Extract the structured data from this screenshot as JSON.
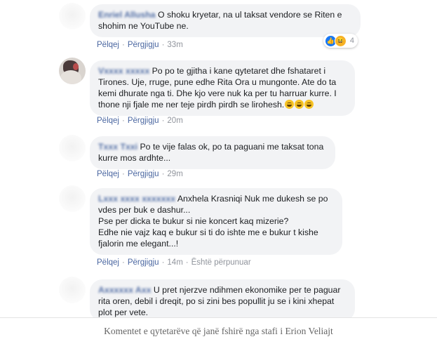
{
  "comments": [
    {
      "author": "Enriel Allusha",
      "text": "O shoku kryetar, na ul taksat vendore se Riten e shohim ne YouTube ne.",
      "actions": {
        "like": "Pëlqej",
        "reply": "Përgjigju",
        "time": "33m"
      },
      "reactions": {
        "icons": [
          "like-icon",
          "haha-icon"
        ],
        "count": "4"
      }
    },
    {
      "author": "Vxxxx xxxxx",
      "text": "Po po te gjitha i kane qytetaret dhe fshataret i Tirones. Uje, rruge, pune edhe Rita Ora u mungonte. Ate do ta kemi dhurate nga ti. Dhe kjo vere nuk ka per tu harruar kurre. I thone nji fjale me ner teje pirdh pirdh se lirohesh.",
      "emojis": [
        "laughing-emoji",
        "laughing-emoji",
        "laughing-emoji"
      ],
      "actions": {
        "like": "Pëlqej",
        "reply": "Përgjigju",
        "time": "20m"
      }
    },
    {
      "author": "Txxx Txxi",
      "text": "Po te vije falas ok, po ta paguani me taksat tona kurre mos ardhte...",
      "actions": {
        "like": "Pëlqej",
        "reply": "Përgjigju",
        "time": "29m"
      }
    },
    {
      "author": "Lxxx xxxx xxxxxxx",
      "text_lines": [
        "Anxhela Krasniqi Nuk me dukesh se po vdes per buk e dashur...",
        "Pse per dicka te bukur si nie koncert kaq mizerie?",
        "Edhe nie vajz kaq e bukur si ti do ishte me e bukur t kishe fjalorin me elegant...!"
      ],
      "actions": {
        "like": "Pëlqej",
        "reply": "Përgjigju",
        "time": "14m",
        "edited": "Është përpunuar"
      }
    },
    {
      "author": "Axxxxxx Axx",
      "text": "U pret njerzve ndihmen ekonomike per te paguar rita oren, debil i dreqit, po si zini bes popullit ju se i kini xhepat plot per vete.",
      "actions": {}
    }
  ],
  "caption": "Komentet e qytetarëve që janë fshirë nga stafi i Erion Veliajt",
  "colors": {
    "link": "#385898",
    "bubble": "#f2f3f5",
    "meta": "#90949c"
  }
}
